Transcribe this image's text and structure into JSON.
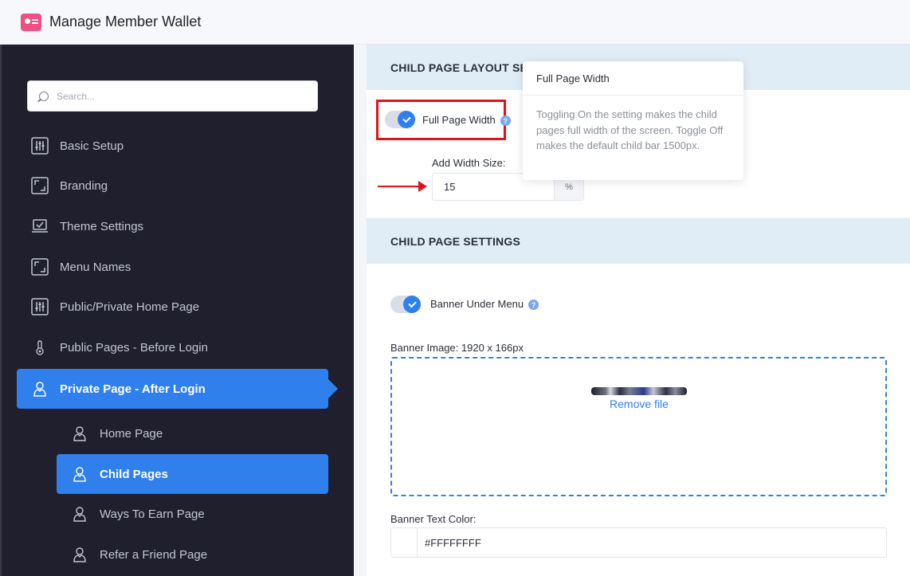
{
  "header": {
    "title": "Manage Member Wallet"
  },
  "sidebar": {
    "search_placeholder": "Search...",
    "items": [
      {
        "label": "Basic Setup",
        "icon": "sliders-icon"
      },
      {
        "label": "Branding",
        "icon": "frame-icon"
      },
      {
        "label": "Theme Settings",
        "icon": "laptop-check-icon"
      },
      {
        "label": "Menu Names",
        "icon": "frame-icon"
      },
      {
        "label": "Public/Private Home Page",
        "icon": "sliders-icon"
      },
      {
        "label": "Public Pages - Before Login",
        "icon": "touch-icon"
      },
      {
        "label": "Private Page - After Login",
        "icon": "user-icon"
      }
    ],
    "subitems": [
      {
        "label": "Home Page",
        "icon": "user-icon"
      },
      {
        "label": "Child Pages",
        "icon": "user-icon"
      },
      {
        "label": "Ways To Earn Page",
        "icon": "user-icon"
      },
      {
        "label": "Refer a Friend Page",
        "icon": "user-icon"
      }
    ]
  },
  "layout_section": {
    "title": "CHILD PAGE LAYOUT SET",
    "full_page_width_label": "Full Page Width",
    "full_page_width_on": true,
    "width_size_label": "Add Width Size:",
    "width_size_value": "15",
    "width_unit": "%"
  },
  "tooltip": {
    "title": "Full Page Width",
    "body": "Toggling On the setting makes the child pages full width of the screen. Toggle Off makes the default child bar 1500px."
  },
  "settings_section": {
    "title": "CHILD PAGE SETTINGS",
    "banner_under_menu_label": "Banner Under Menu",
    "banner_under_menu_on": true,
    "banner_image_label": "Banner Image: 1920 x 166px",
    "remove_file_label": "Remove file",
    "banner_text_color_label": "Banner Text Color:",
    "banner_text_color_value": "#FFFFFFFF"
  },
  "colors": {
    "accent": "#2f80ed",
    "sidebar_bg": "#1f1f2d",
    "annotation_red": "#e0121b"
  }
}
